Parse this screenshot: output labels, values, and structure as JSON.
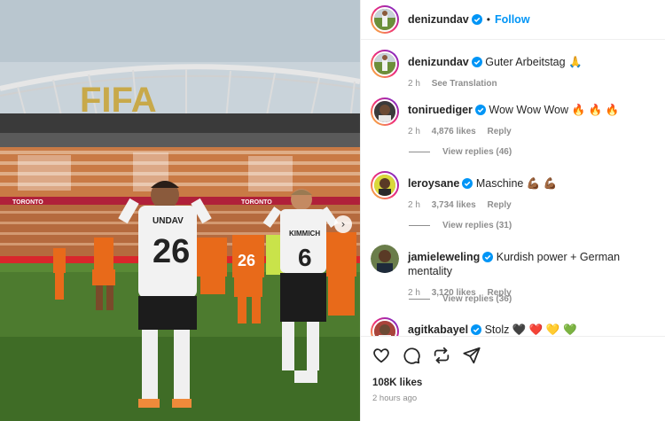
{
  "photo": {
    "stadium_sign": "FIFA",
    "board_text": "TORONTO",
    "player_left": {
      "name": "UNDAV",
      "number": "26"
    },
    "player_right": {
      "name": "KIMMICH",
      "number": "6"
    },
    "opponent_number": "26"
  },
  "header": {
    "username": "denizundav",
    "separator": "•",
    "follow_label": "Follow"
  },
  "comments": [
    {
      "username": "denizundav",
      "text": "Guter Arbeitstag 🙏",
      "time": "2 h",
      "likes": "",
      "action": "See Translation",
      "replies": ""
    },
    {
      "username": "toniruediger",
      "text": "Wow Wow Wow 🔥 🔥 🔥",
      "time": "2 h",
      "likes": "4,876 likes",
      "action": "Reply",
      "replies": "View replies (46)"
    },
    {
      "username": "leroysane",
      "text": "Maschine 💪🏾 💪🏾",
      "time": "2 h",
      "likes": "3,734 likes",
      "action": "Reply",
      "replies": "View replies (31)"
    },
    {
      "username": "jamieleweling",
      "text": "Kurdish power + German mentality",
      "time": "2 h",
      "likes": "3,120 likes",
      "action": "Reply",
      "replies": "View replies (36)"
    },
    {
      "username": "agitkabayel",
      "text": "Stolz 🖤 ❤️ 💛 💚",
      "time": "",
      "likes": "",
      "action": "",
      "replies": ""
    }
  ],
  "footer": {
    "likes": "108K likes",
    "time_ago": "2 hours ago"
  },
  "colors": {
    "accent": "#0095f6",
    "verified": "#0095f6",
    "muted": "#8e8e8e"
  }
}
